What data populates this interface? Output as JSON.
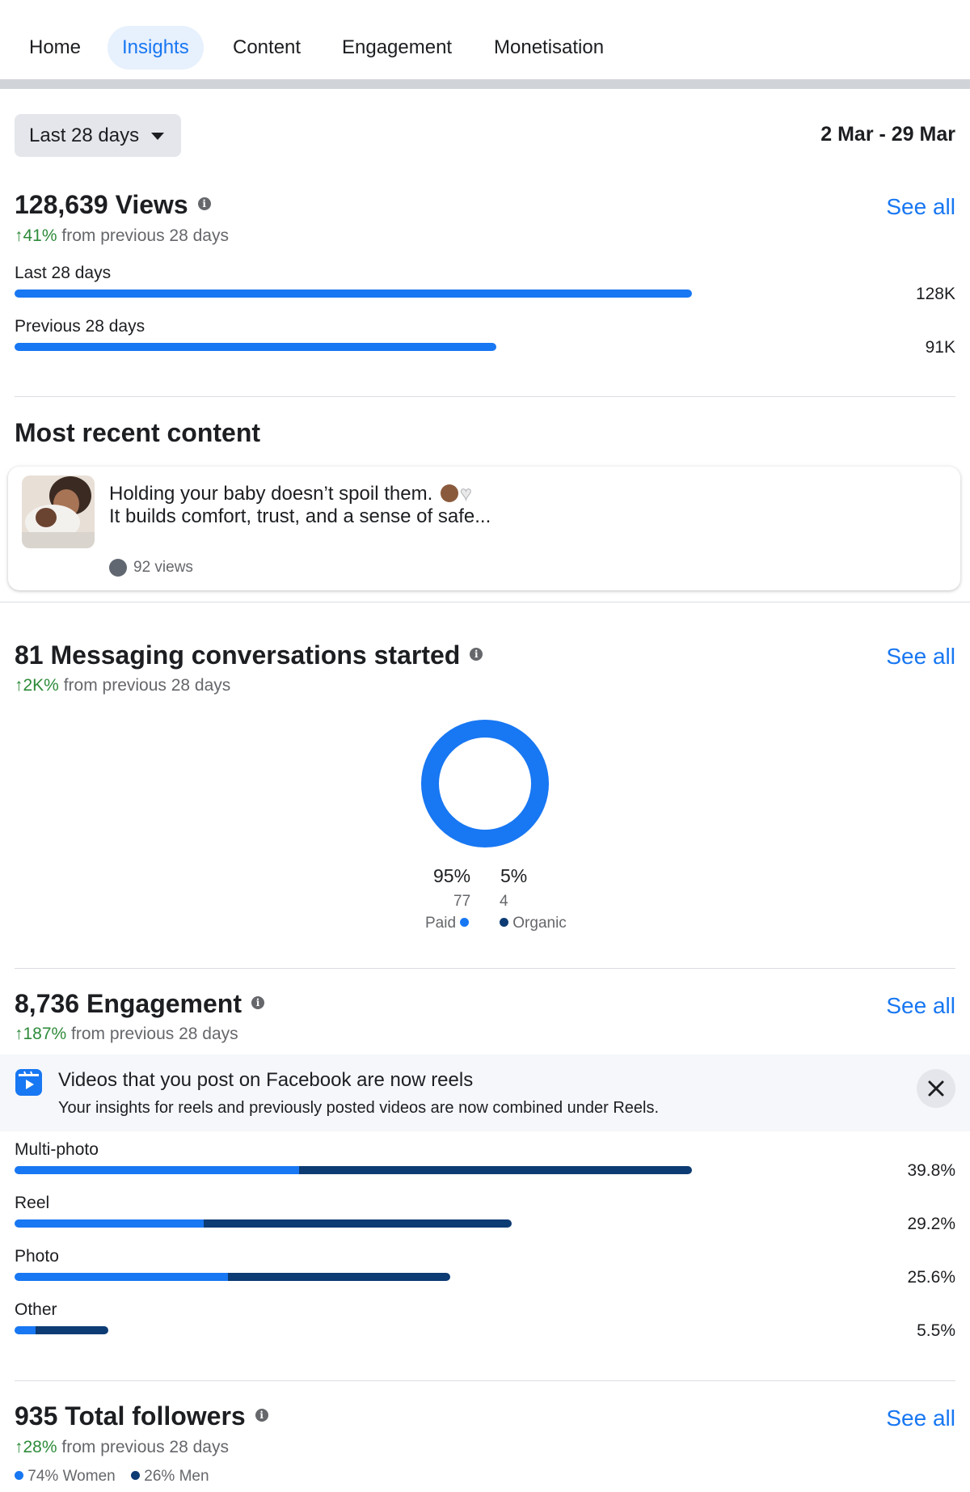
{
  "tabs": [
    {
      "label": "Home",
      "active": false
    },
    {
      "label": "Insights",
      "active": true
    },
    {
      "label": "Content",
      "active": false
    },
    {
      "label": "Engagement",
      "active": false
    },
    {
      "label": "Monetisation",
      "active": false
    }
  ],
  "date_filter": {
    "label": "Last 28 days",
    "range": "2 Mar - 29 Mar"
  },
  "views": {
    "title": "128,639 Views",
    "see_all": "See all",
    "delta": "41%",
    "delta_suffix": " from previous 28 days",
    "rows": [
      {
        "label": "Last 28 days",
        "value": "128K",
        "amount": 128
      },
      {
        "label": "Previous 28 days",
        "value": "91K",
        "amount": 91
      }
    ]
  },
  "recent": {
    "title": "Most recent content",
    "line1": "Holding your baby doesn’t spoil them.",
    "line2": "It builds comfort, trust, and a sense of safe...",
    "views": "92 views"
  },
  "messaging": {
    "title": "81 Messaging conversations started",
    "see_all": "See all",
    "delta": "2K%",
    "delta_suffix": " from previous 28 days",
    "paid": {
      "pct": "95%",
      "count": "77",
      "label": "Paid"
    },
    "organic": {
      "pct": "5%",
      "count": "4",
      "label": "Organic"
    }
  },
  "engagement": {
    "title": "8,736 Engagement",
    "see_all": "See all",
    "delta": "187%",
    "delta_suffix": " from previous 28 days",
    "notice_title": "Videos that you post on Facebook are now reels",
    "notice_sub": "Your insights for reels and previously posted videos are now combined under Reels.",
    "rows": [
      {
        "label": "Multi-photo",
        "value": "39.8%",
        "share": 39.8,
        "light_fraction": 0.42
      },
      {
        "label": "Reel",
        "value": "29.2%",
        "share": 29.2,
        "light_fraction": 0.38
      },
      {
        "label": "Photo",
        "value": "25.6%",
        "share": 25.6,
        "light_fraction": 0.49
      },
      {
        "label": "Other",
        "value": "5.5%",
        "share": 5.5,
        "light_fraction": 0.22
      }
    ]
  },
  "followers": {
    "title": "935 Total followers",
    "see_all": "See all",
    "delta": "28%",
    "delta_suffix": " from previous 28 days",
    "women": "74% Women",
    "men": "26% Men"
  },
  "colors": {
    "accent": "#1877f2",
    "dark_blue": "#0d3b73",
    "positive": "#2e8b3a"
  }
}
